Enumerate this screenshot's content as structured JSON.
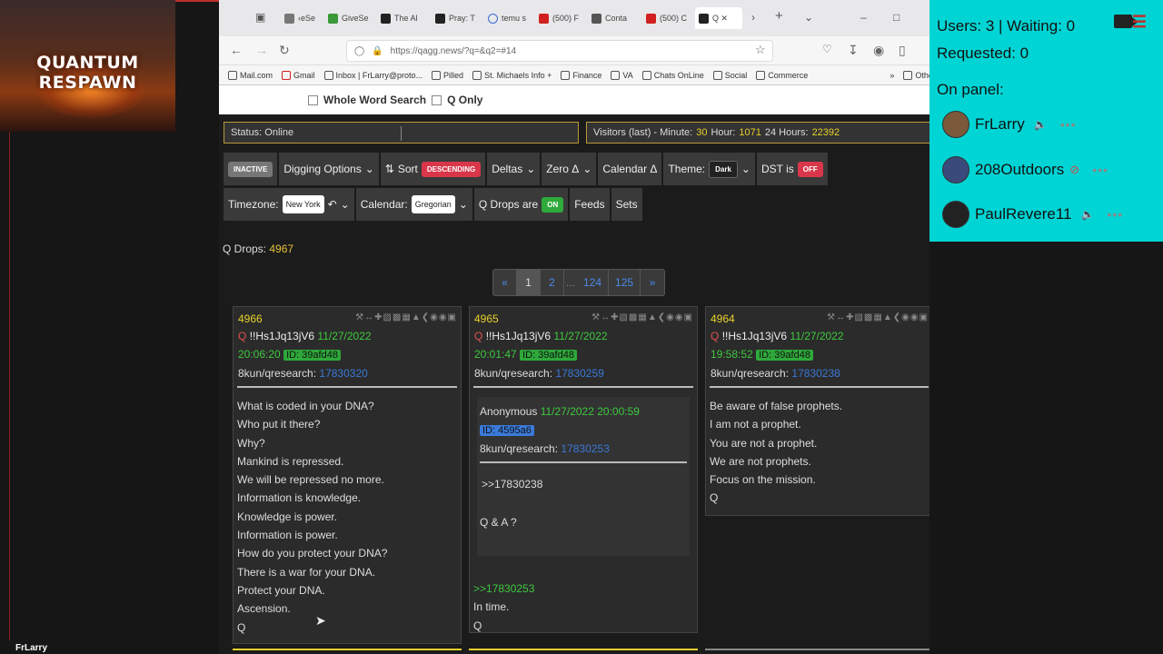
{
  "overlay": {
    "channel_logo": "QUANTUM RESPAWN",
    "streamer_name": "FrLarry"
  },
  "browser": {
    "tabs": [
      {
        "label": "‹eSe",
        "color": "#777"
      },
      {
        "label": "GiveSe",
        "color": "#3a9a3a"
      },
      {
        "label": "The Al",
        "color": "#222"
      },
      {
        "label": "Pray: T",
        "color": "#222"
      },
      {
        "label": "temu s",
        "color": "#3a6ad8"
      },
      {
        "label": "(500) F",
        "color": "#d02020"
      },
      {
        "label": "Conta",
        "color": "#555"
      },
      {
        "label": "(500) C",
        "color": "#d02020"
      },
      {
        "label": "Q ✕",
        "color": "#222"
      }
    ],
    "url": "https://qagg.news/?q=&q2=#14",
    "bookmarks": [
      "Mail.com",
      "Gmail",
      "Inbox | FrLarry@proto...",
      "Pilled",
      "St. Michaels Info +",
      "Finance",
      "VA",
      "Chats OnLine",
      "Social",
      "Commerce",
      "Other Bookma"
    ]
  },
  "search_options": {
    "whole_word": "Whole Word Search",
    "q_only": "Q Only"
  },
  "status": {
    "label": "Status: Online"
  },
  "visitors": {
    "prefix": "Visitors (last) - Minute:",
    "minute": "30",
    "hour_label": "Hour:",
    "hour": "1071",
    "day_label": "24 Hours:",
    "day": "22392"
  },
  "toolbar": {
    "inactive": "INACTIVE",
    "digging": "Digging Options",
    "sort": "Sort",
    "descending": "DESCENDING",
    "deltas": "Deltas",
    "zero": "Zero Δ",
    "calendar_delta": "Calendar Δ",
    "theme": "Theme:",
    "theme_value": "Dark",
    "dst": "DST is",
    "dst_value": "OFF"
  },
  "toolbar2": {
    "timezone": "Timezone:",
    "timezone_value": "New York",
    "calendar": "Calendar:",
    "calendar_value": "Gregorian",
    "qdrops_are": "Q Drops are",
    "qdrops_value": "ON",
    "feeds": "Feeds",
    "sets": "Sets"
  },
  "qdrops": {
    "label": "Q Drops:",
    "count": "4967"
  },
  "pager": {
    "prev": "«",
    "pages": [
      "1",
      "2"
    ],
    "ellipsis": "...",
    "late_pages": [
      "124",
      "125"
    ],
    "next": "»"
  },
  "posts": [
    {
      "num": "4966",
      "q": "Q",
      "trip": "!!Hs1Jq13jV6",
      "date": "11/27/2022",
      "time": "20:06:20",
      "id": "ID: 39afd48",
      "board": "8kun/qresearch:",
      "post_link": "17830320",
      "lines": [
        "What is coded in your DNA?",
        "Who put it there?",
        "Why?",
        "Mankind is repressed.",
        "We will be repressed no more.",
        "Information is knowledge.",
        "Knowledge is power.",
        "Information is power.",
        "How do you protect your DNA?",
        "There is a war for your DNA.",
        "Protect your DNA.",
        "Ascension.",
        "Q"
      ]
    },
    {
      "num": "4965",
      "q": "Q",
      "trip": "!!Hs1Jq13jV6",
      "date": "11/27/2022",
      "time": "20:01:47",
      "id": "ID: 39afd48",
      "board": "8kun/qresearch:",
      "post_link": "17830259",
      "quoted": {
        "author": "Anonymous",
        "date": "11/27/2022 20:00:59",
        "id": "ID: 4595a6",
        "board": "8kun/qresearch:",
        "post_link": "17830253",
        "ref": ">>17830238",
        "text": "Q & A ?"
      },
      "reply_ref": ">>17830253",
      "lines": [
        "In time.",
        "Q"
      ]
    },
    {
      "num": "4964",
      "q": "Q",
      "trip": "!!Hs1Jq13jV6",
      "date": "11/27/2022",
      "time": "19:58:52",
      "id": "ID: 39afd48",
      "board": "8kun/qresearch:",
      "post_link": "17830238",
      "lines": [
        "Be aware of false prophets.",
        "I am not a prophet.",
        "You are not a prophet.",
        "We are not prophets.",
        "Focus on the mission.",
        "Q"
      ]
    }
  ],
  "panel": {
    "users": "Users: 3 | Waiting: 0",
    "requested": "Requested: 0",
    "on_panel": "On panel:",
    "members": [
      {
        "name": "FrLarry",
        "avatar_color": "#7a5a3a"
      },
      {
        "name": "208Outdoors",
        "avatar_color": "#3a4a7a"
      },
      {
        "name": "PaulRevere11",
        "avatar_color": "#222222"
      }
    ]
  }
}
